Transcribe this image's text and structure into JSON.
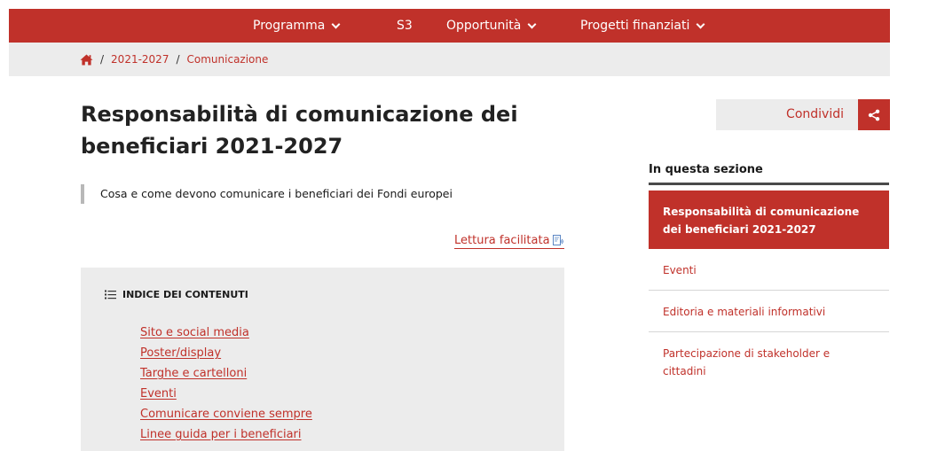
{
  "nav": {
    "items": [
      {
        "label": "Programma",
        "dropdown": true
      },
      {
        "label": "S3",
        "dropdown": false
      },
      {
        "label": "Opportunità",
        "dropdown": true
      },
      {
        "label": "Progetti finanziati",
        "dropdown": true
      }
    ]
  },
  "breadcrumb": {
    "items": [
      "2021-2027",
      "Comunicazione"
    ],
    "separator": "/"
  },
  "page": {
    "title": "Responsabilità di comunicazione dei beneficiari 2021-2027",
    "lead": "Cosa e come devono comunicare i beneficiari dei Fondi europei",
    "easy_read": "Lettura facilitata"
  },
  "toc": {
    "heading": "INDICE DEI CONTENUTI",
    "links": [
      "Sito e social media",
      "Poster/display",
      "Targhe e cartelloni",
      "Eventi",
      "Comunicare conviene sempre",
      "Linee guida per i beneficiari"
    ]
  },
  "share": {
    "label": "Condividi"
  },
  "sidebar": {
    "title": "In questa sezione",
    "items": [
      {
        "label": "Responsabilità di comunicazione dei beneficiari 2021-2027",
        "active": true
      },
      {
        "label": "Eventi",
        "active": false
      },
      {
        "label": "Editoria e materiali informativi",
        "active": false
      },
      {
        "label": "Partecipazione di stakeholder e cittadini",
        "active": false
      }
    ]
  },
  "colors": {
    "accent": "#c0312a",
    "panel": "#ececec",
    "text": "#1a1a1a"
  },
  "icons": [
    "home-icon",
    "chevron-down-icon",
    "easy-read-icon",
    "list-icon",
    "share-icon"
  ]
}
